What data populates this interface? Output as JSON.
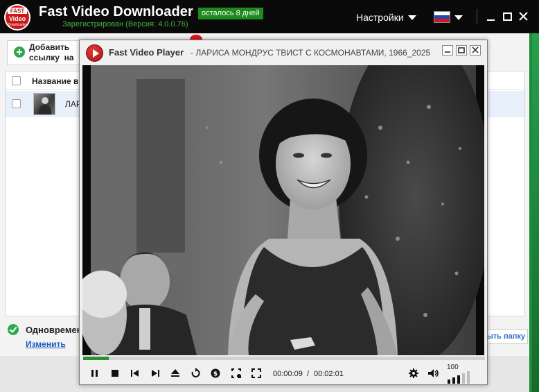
{
  "app": {
    "title": "Fast Video Downloader",
    "logo_label": "FAST Video Downloader",
    "days_left": "осталось 8 дней",
    "registered": "Зарегистрирован (Версия: 4.0.0.76)",
    "settings_label": "Настройки",
    "language_flag": "russia-flag",
    "colors": {
      "titlebar": "#0a0a0a",
      "badge": "#1c8a1c",
      "registered": "#3fb13f"
    }
  },
  "toolbar": {
    "add_link_line1": "Добавить",
    "add_link_line2": "ссылку  на"
  },
  "list": {
    "column_name": "Название ви",
    "rows": [
      {
        "title": "ЛАР"
      }
    ]
  },
  "footer": {
    "simultaneous_label": "Одновремен",
    "change_link": "Изменить",
    "open_folder": "ыть папку"
  },
  "player": {
    "name": "Fast Video Player",
    "video_title": "- ЛАРИСА МОНДРУС  ТВИСТ С КОСМОНАВТАМИ,  1966_2025",
    "current_time": "00:00:09",
    "separator": "/",
    "total_time": "00:02:01",
    "progress_fraction": 0.063,
    "volume": "100",
    "volume_fraction": 0.6,
    "icons": [
      "pause-icon",
      "stop-icon",
      "previous-icon",
      "next-icon",
      "eject-icon",
      "repeat-icon",
      "speed-icon",
      "crop-icon",
      "fullscreen-icon",
      "settings-icon",
      "speaker-icon"
    ]
  }
}
